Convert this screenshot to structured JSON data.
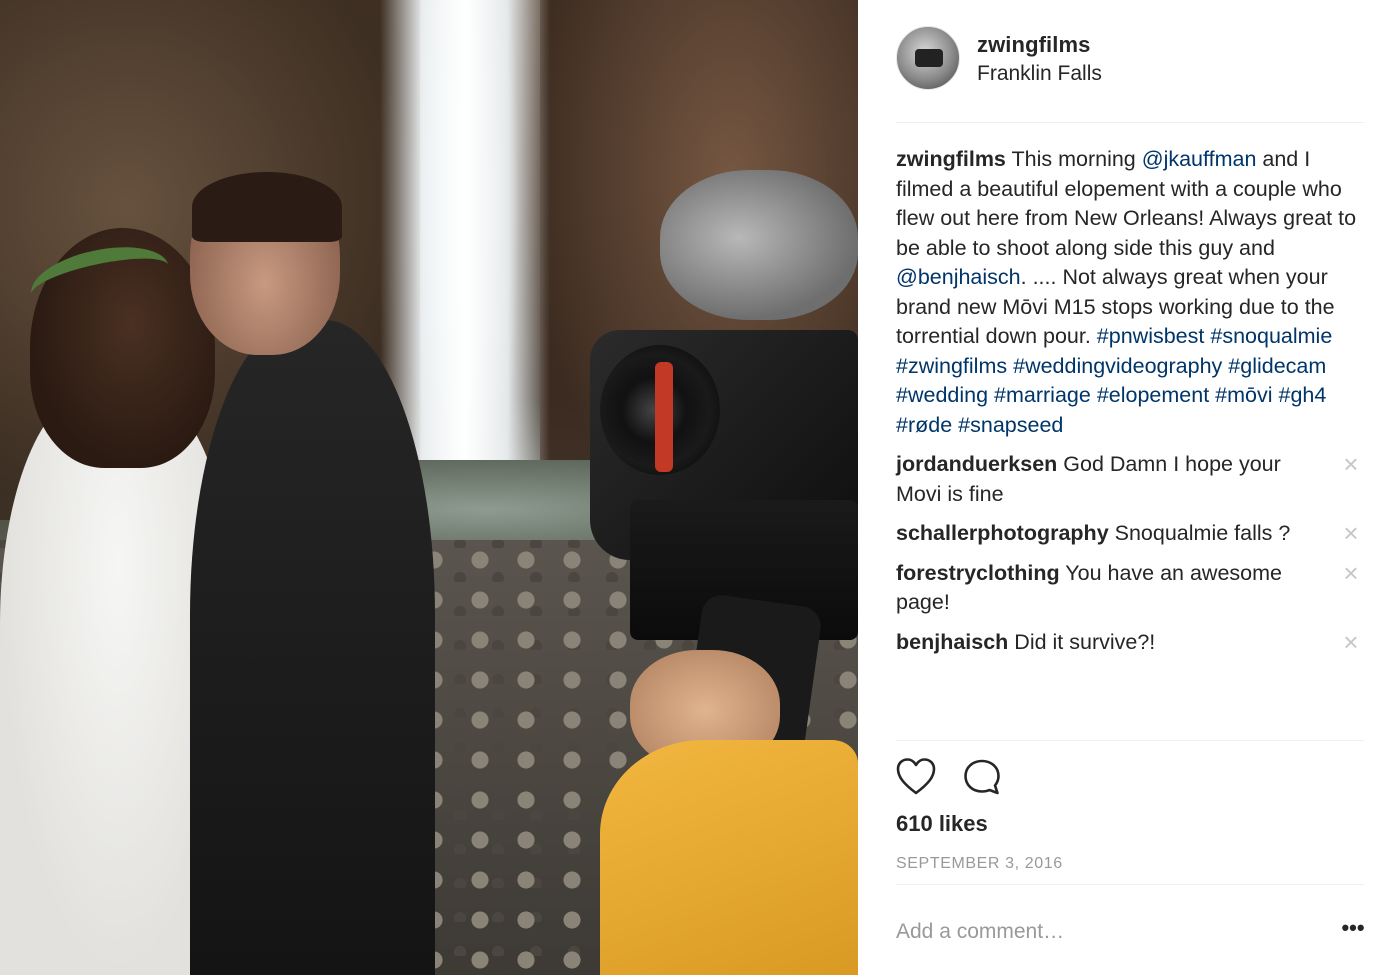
{
  "photo": {
    "description_icon": "wedding-waterfall-photo"
  },
  "header": {
    "username": "zwingfilms",
    "location": "Franklin Falls"
  },
  "caption": {
    "username": "zwingfilms",
    "parts": [
      {
        "text": " This morning ",
        "link": false
      },
      {
        "text": "@jkauffman",
        "link": true
      },
      {
        "text": " and I filmed a beautiful elopement with a couple who flew out here from New Orleans! Always great to be able to shoot along side this guy and ",
        "link": false
      },
      {
        "text": "@benjhaisch",
        "link": true
      },
      {
        "text": ". .... Not always great when your brand new Mōvi M15 stops working due to the torrential down pour. ",
        "link": false
      },
      {
        "text": "#pnwisbest",
        "link": true
      },
      {
        "text": " ",
        "link": false
      },
      {
        "text": "#snoqualmie",
        "link": true
      },
      {
        "text": " ",
        "link": false
      },
      {
        "text": "#zwingfilms",
        "link": true
      },
      {
        "text": " ",
        "link": false
      },
      {
        "text": "#weddingvideography",
        "link": true
      },
      {
        "text": " ",
        "link": false
      },
      {
        "text": "#glidecam",
        "link": true
      },
      {
        "text": " ",
        "link": false
      },
      {
        "text": "#wedding",
        "link": true
      },
      {
        "text": " ",
        "link": false
      },
      {
        "text": "#marriage",
        "link": true
      },
      {
        "text": " ",
        "link": false
      },
      {
        "text": "#elopement",
        "link": true
      },
      {
        "text": " ",
        "link": false
      },
      {
        "text": "#mōvi",
        "link": true
      },
      {
        "text": " ",
        "link": false
      },
      {
        "text": "#gh4",
        "link": true
      },
      {
        "text": " ",
        "link": false
      },
      {
        "text": "#røde",
        "link": true
      },
      {
        "text": " ",
        "link": false
      },
      {
        "text": "#snapseed",
        "link": true
      }
    ]
  },
  "comments": [
    {
      "username": "jordanduerksen",
      "text": " God Damn I hope your Movi is fine"
    },
    {
      "username": "schallerphotography",
      "text": " Snoqualmie falls ?"
    },
    {
      "username": "forestryclothing",
      "text": " You have an awesome page!"
    },
    {
      "username": "benjhaisch",
      "text": " Did it survive?!"
    }
  ],
  "close_glyph": "×",
  "likes": "610 likes",
  "date": "SEPTEMBER 3, 2016",
  "add_comment": {
    "placeholder": "Add a comment…"
  },
  "more_glyph": "•••",
  "icons": [
    "heart-icon",
    "comment-bubble-icon",
    "close-icon",
    "more-options-icon"
  ],
  "colors": {
    "link": "#003569",
    "text": "#262626",
    "muted": "#999999"
  }
}
